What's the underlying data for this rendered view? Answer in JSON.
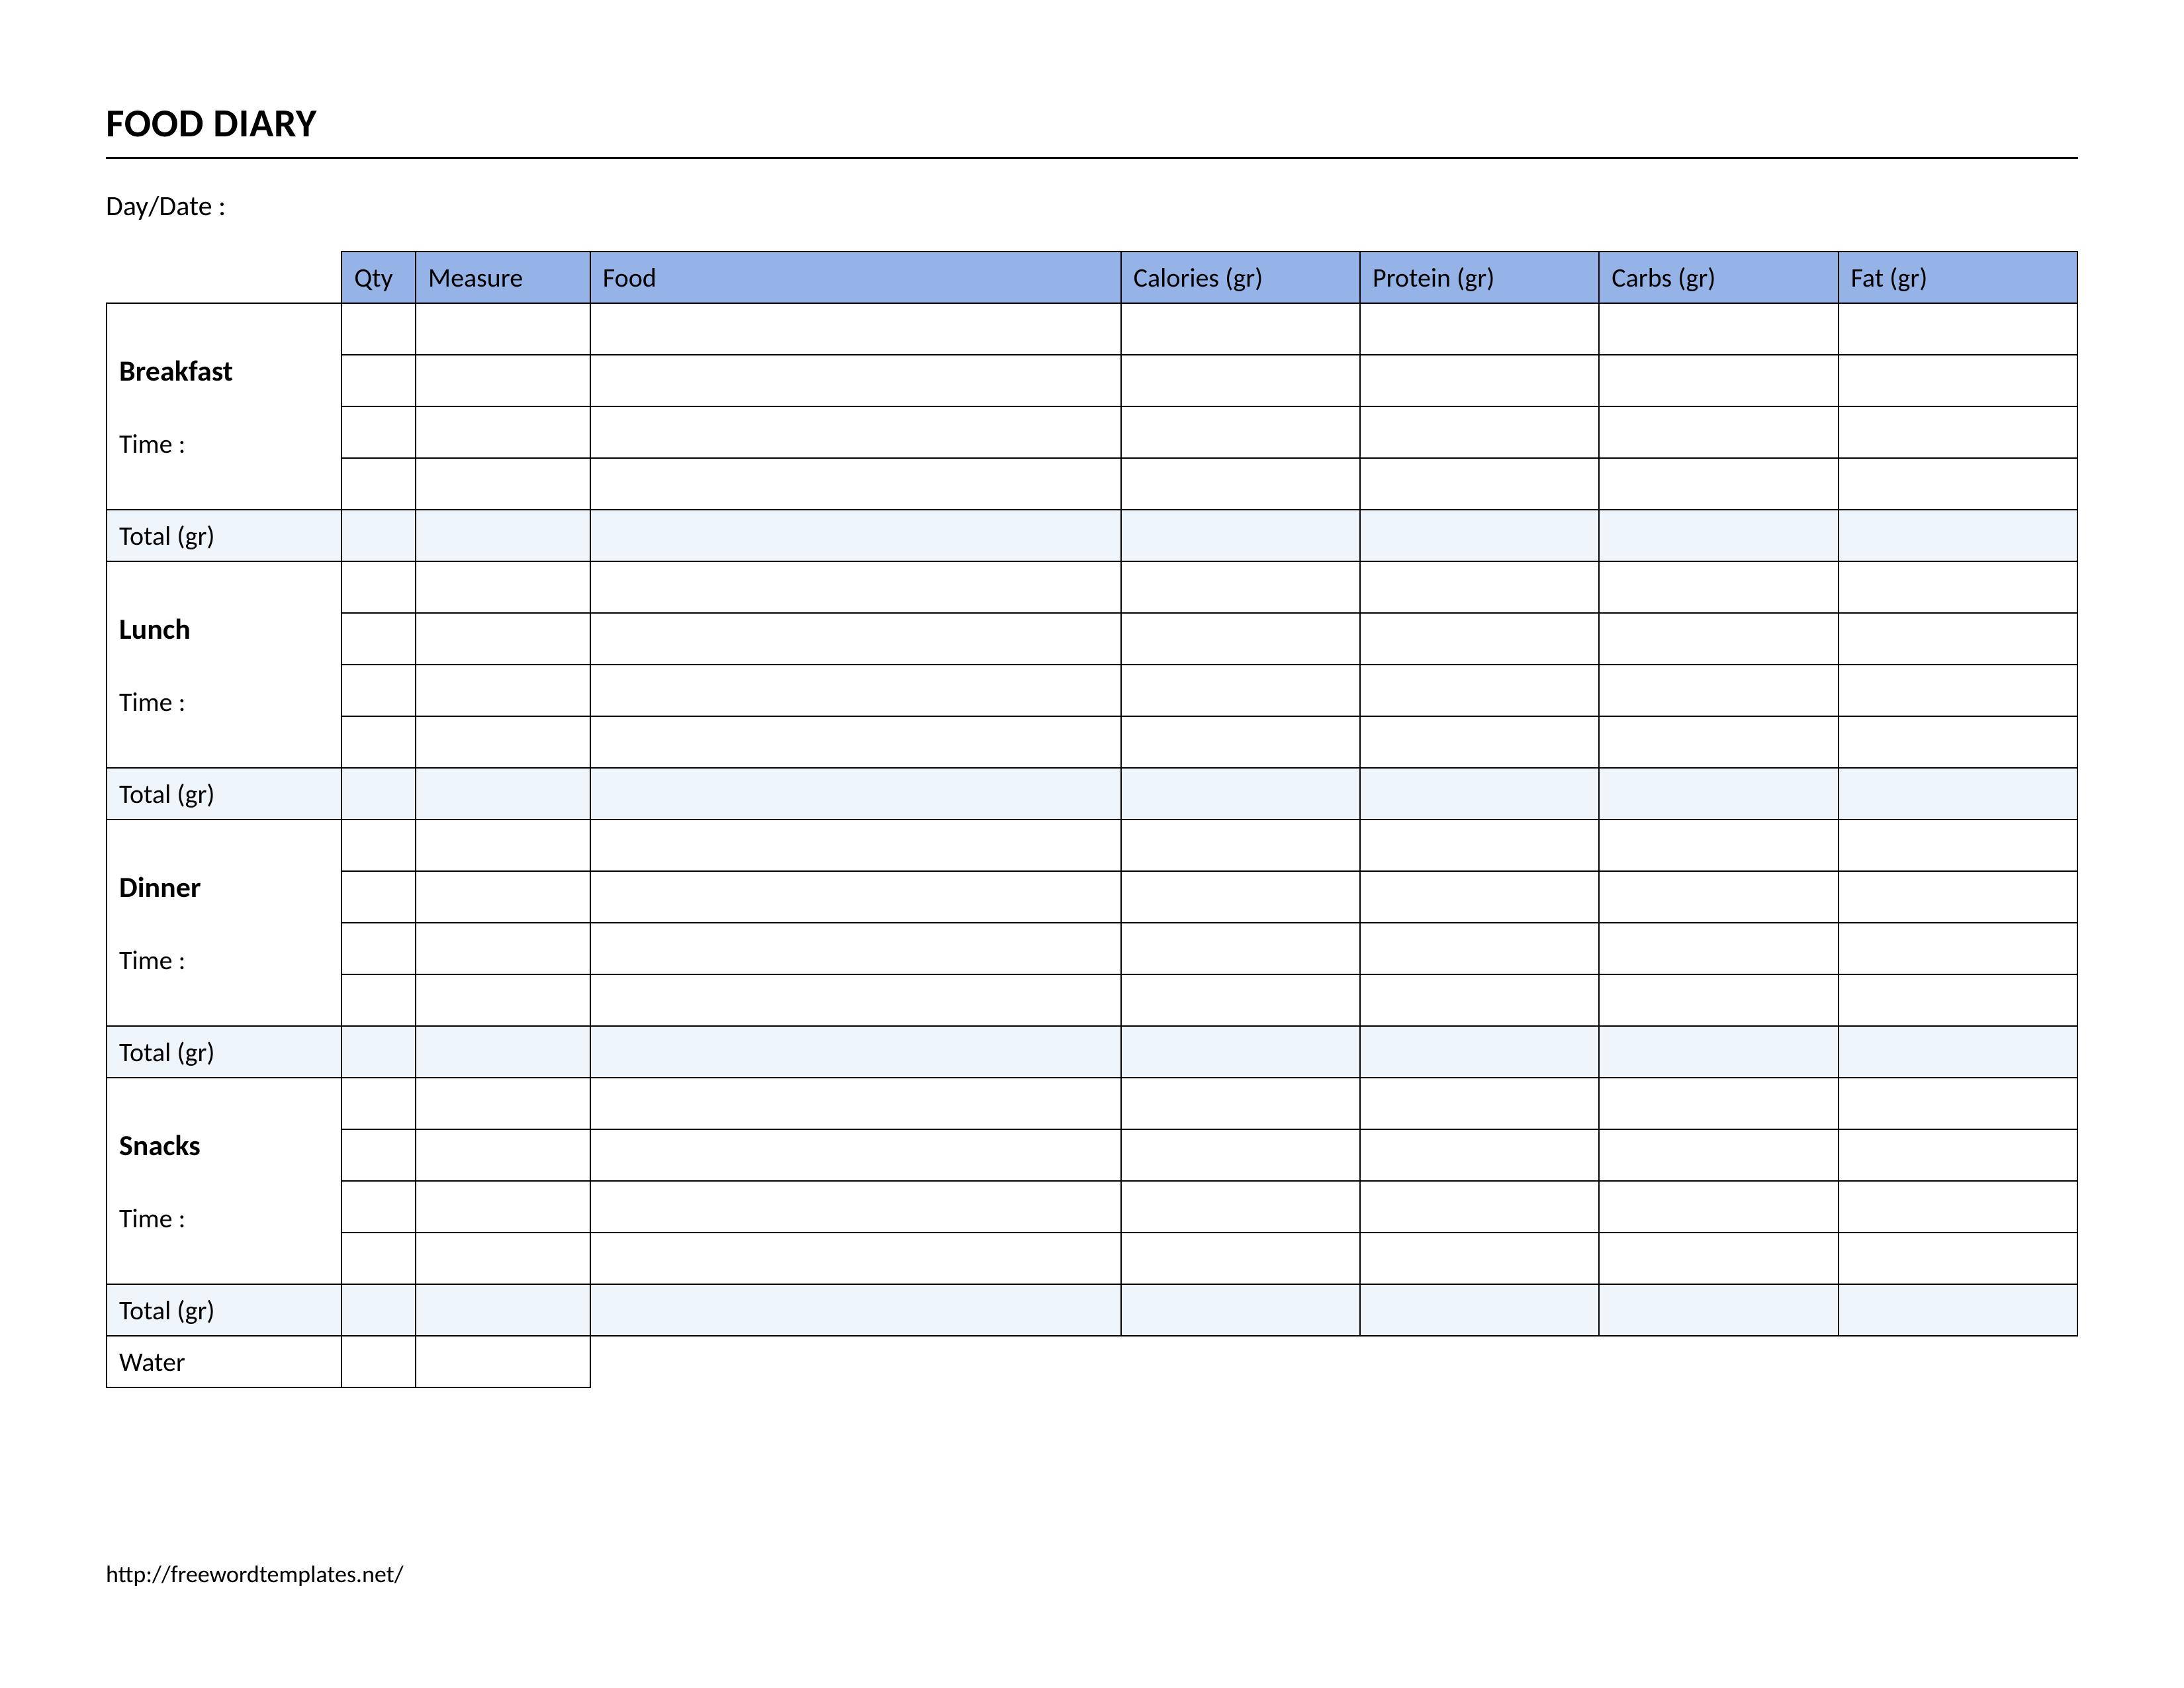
{
  "title": "FOOD DIARY",
  "daydate_label": "Day/Date :",
  "columns": {
    "qty": "Qty",
    "measure": "Measure",
    "food": "Food",
    "calories": "Calories (gr)",
    "protein": "Protein (gr)",
    "carbs": "Carbs (gr)",
    "fat": "Fat (gr)"
  },
  "sections": {
    "breakfast": {
      "name": "Breakfast",
      "time_label": "Time :",
      "total_label": "Total (gr)"
    },
    "lunch": {
      "name": "Lunch",
      "time_label": "Time :",
      "total_label": "Total (gr)"
    },
    "dinner": {
      "name": "Dinner",
      "time_label": "Time :",
      "total_label": "Total (gr)"
    },
    "snacks": {
      "name": "Snacks",
      "time_label": "Time :",
      "total_label": "Total (gr)"
    }
  },
  "water_label": "Water",
  "footer_url": "http://freewordtemplates.net/"
}
